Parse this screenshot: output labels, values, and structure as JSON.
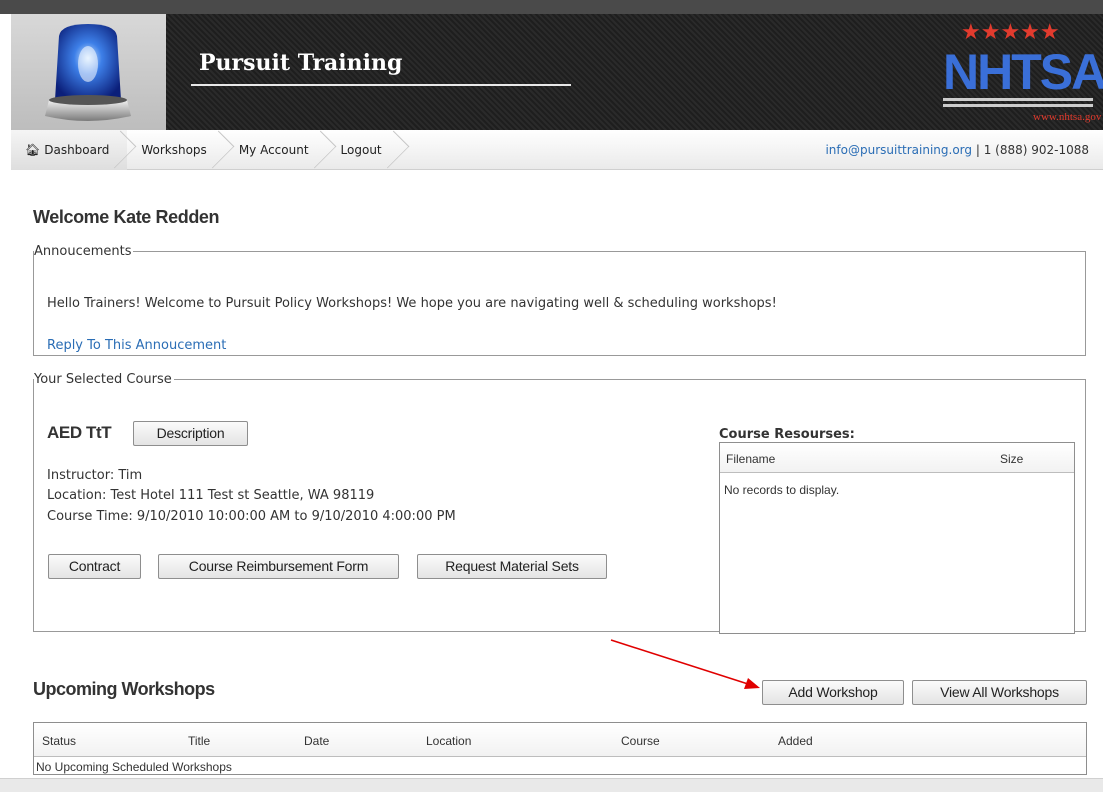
{
  "header": {
    "title": "Pursuit Training",
    "agency_logo_text": "NHTSA",
    "agency_url": "www.nhtsa.gov"
  },
  "nav": {
    "items": [
      {
        "label": "Dashboard",
        "icon": "home-icon"
      },
      {
        "label": "Workshops"
      },
      {
        "label": "My Account"
      },
      {
        "label": "Logout"
      }
    ],
    "contact_email": "info@pursuittraining.org",
    "contact_sep": " | ",
    "contact_phone": "1 (888) 902-1088"
  },
  "welcome": "Welcome Kate Redden",
  "announcements": {
    "legend": "Annoucements",
    "message": "Hello Trainers! Welcome to Pursuit Policy Workshops! We hope you are navigating well & scheduling workshops!",
    "reply_link": "Reply To This Annoucement"
  },
  "course": {
    "legend": "Your Selected Course",
    "name": "AED TtT",
    "description_button": "Description",
    "instructor": "Instructor: Tim",
    "location": "Location: Test Hotel 111 Test st Seattle, WA 98119",
    "time": "Course Time: 9/10/2010 10:00:00 AM to 9/10/2010 4:00:00 PM",
    "buttons": {
      "contract": "Contract",
      "reimbursement": "Course Reimbursement Form",
      "materials": "Request Material Sets"
    },
    "resources": {
      "title": "Course Resourses:",
      "columns": [
        "Filename",
        "Size"
      ],
      "empty": "No records to display."
    }
  },
  "upcoming": {
    "title": "Upcoming Workshops",
    "add_button": "Add Workshop",
    "view_all_button": "View All Workshops",
    "columns": [
      "Status",
      "Title",
      "Date",
      "Location",
      "Course",
      "Added"
    ],
    "empty": "No Upcoming Scheduled Workshops"
  },
  "colors": {
    "link": "#2a6db5",
    "annotation_arrow": "#e00000",
    "header_bg": "#222222"
  }
}
